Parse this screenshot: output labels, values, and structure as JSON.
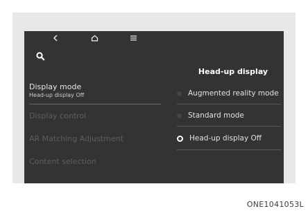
{
  "nav": {
    "back_icon": "chevron-left-icon",
    "home_icon": "home-icon",
    "menu_icon": "hamburger-menu-icon",
    "search_icon": "search-icon"
  },
  "sidebar": {
    "items": [
      {
        "label": "Display mode",
        "value": "Head-up display Off",
        "active": true
      },
      {
        "label": "Display control",
        "active": false
      },
      {
        "label": "AR Matching Adjustment",
        "active": false
      },
      {
        "label": "Content selection",
        "active": false
      }
    ]
  },
  "panel": {
    "title": "Head-up display",
    "options": [
      {
        "label": "Augmented reality mode",
        "selected": false
      },
      {
        "label": "Standard mode",
        "selected": false
      },
      {
        "label": "Head-up display Off",
        "selected": true
      }
    ]
  },
  "caption": "ONE1041053L",
  "colors": {
    "screen_bg": "#333333",
    "frame_bg": "#e8e8e8",
    "text": "#e2e2e2",
    "dim_text": "#5e5e5e"
  }
}
